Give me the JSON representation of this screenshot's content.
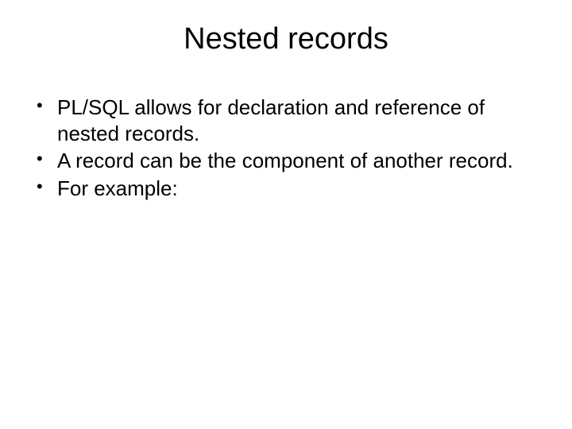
{
  "slide": {
    "title": "Nested records",
    "bullets": [
      "PL/SQL allows for declaration and reference of nested records.",
      "A record can be the component of another record.",
      "For example:"
    ]
  }
}
